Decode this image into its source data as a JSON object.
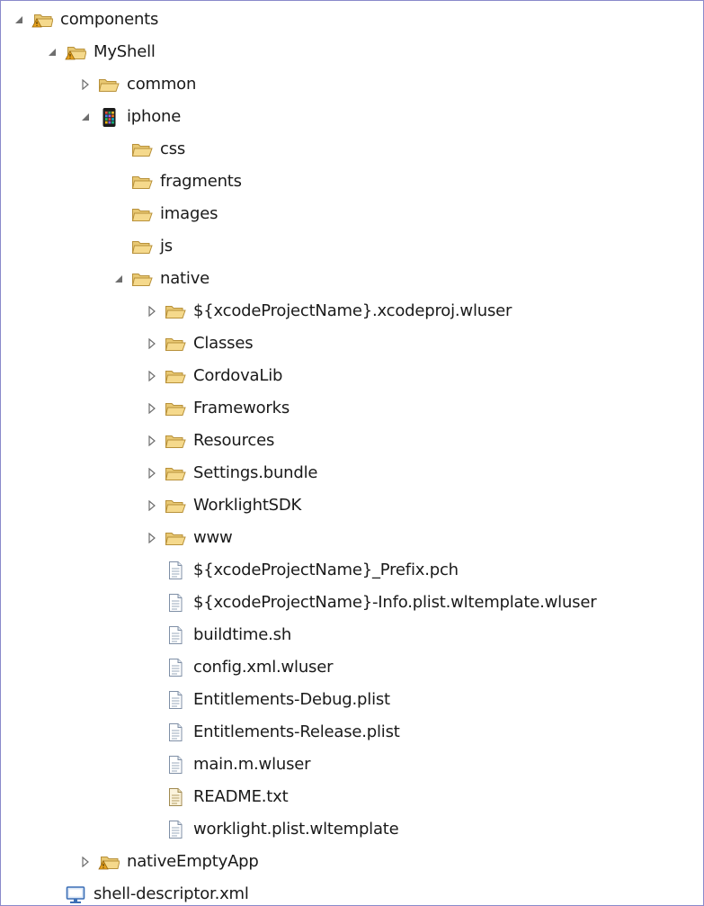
{
  "tree": [
    {
      "label": "components",
      "depth": 0,
      "icon": "warning-folder-icon",
      "twisty": "expanded"
    },
    {
      "label": "MyShell",
      "depth": 1,
      "icon": "warning-folder-icon",
      "twisty": "expanded"
    },
    {
      "label": "common",
      "depth": 2,
      "icon": "folder-icon",
      "twisty": "collapsed"
    },
    {
      "label": "iphone",
      "depth": 2,
      "icon": "iphone-icon",
      "twisty": "expanded"
    },
    {
      "label": "css",
      "depth": 3,
      "icon": "folder-icon",
      "twisty": "none"
    },
    {
      "label": "fragments",
      "depth": 3,
      "icon": "folder-icon",
      "twisty": "none"
    },
    {
      "label": "images",
      "depth": 3,
      "icon": "folder-icon",
      "twisty": "none"
    },
    {
      "label": "js",
      "depth": 3,
      "icon": "folder-icon",
      "twisty": "none"
    },
    {
      "label": "native",
      "depth": 3,
      "icon": "folder-icon",
      "twisty": "expanded"
    },
    {
      "label": "${xcodeProjectName}.xcodeproj.wluser",
      "depth": 4,
      "icon": "folder-icon",
      "twisty": "collapsed"
    },
    {
      "label": "Classes",
      "depth": 4,
      "icon": "folder-icon",
      "twisty": "collapsed"
    },
    {
      "label": "CordovaLib",
      "depth": 4,
      "icon": "folder-icon",
      "twisty": "collapsed"
    },
    {
      "label": "Frameworks",
      "depth": 4,
      "icon": "folder-icon",
      "twisty": "collapsed"
    },
    {
      "label": "Resources",
      "depth": 4,
      "icon": "folder-icon",
      "twisty": "collapsed"
    },
    {
      "label": "Settings.bundle",
      "depth": 4,
      "icon": "folder-icon",
      "twisty": "collapsed"
    },
    {
      "label": "WorklightSDK",
      "depth": 4,
      "icon": "folder-icon",
      "twisty": "collapsed"
    },
    {
      "label": "www",
      "depth": 4,
      "icon": "folder-icon",
      "twisty": "collapsed"
    },
    {
      "label": "${xcodeProjectName}_Prefix.pch",
      "depth": 4,
      "icon": "file-icon",
      "twisty": "none"
    },
    {
      "label": "${xcodeProjectName}-Info.plist.wltemplate.wluser",
      "depth": 4,
      "icon": "file-icon",
      "twisty": "none"
    },
    {
      "label": "buildtime.sh",
      "depth": 4,
      "icon": "file-icon",
      "twisty": "none"
    },
    {
      "label": "config.xml.wluser",
      "depth": 4,
      "icon": "file-icon",
      "twisty": "none"
    },
    {
      "label": "Entitlements-Debug.plist",
      "depth": 4,
      "icon": "file-icon",
      "twisty": "none"
    },
    {
      "label": "Entitlements-Release.plist",
      "depth": 4,
      "icon": "file-icon",
      "twisty": "none"
    },
    {
      "label": "main.m.wluser",
      "depth": 4,
      "icon": "file-icon",
      "twisty": "none"
    },
    {
      "label": "README.txt",
      "depth": 4,
      "icon": "text-file-icon",
      "twisty": "none"
    },
    {
      "label": "worklight.plist.wltemplate",
      "depth": 4,
      "icon": "file-icon",
      "twisty": "none"
    },
    {
      "label": "nativeEmptyApp",
      "depth": 2,
      "icon": "warning-folder-icon",
      "twisty": "collapsed"
    },
    {
      "label": "shell-descriptor.xml",
      "depth": 1,
      "icon": "monitor-icon",
      "twisty": "none"
    }
  ],
  "colors": {
    "folder_fill": "#f5d98c",
    "folder_stroke": "#b8913a",
    "warning": "#e7a21e",
    "twisty": "#6e6e6e",
    "file_stroke": "#7f8fa6",
    "monitor": "#3b6fb6",
    "border": "#8a8acb"
  }
}
